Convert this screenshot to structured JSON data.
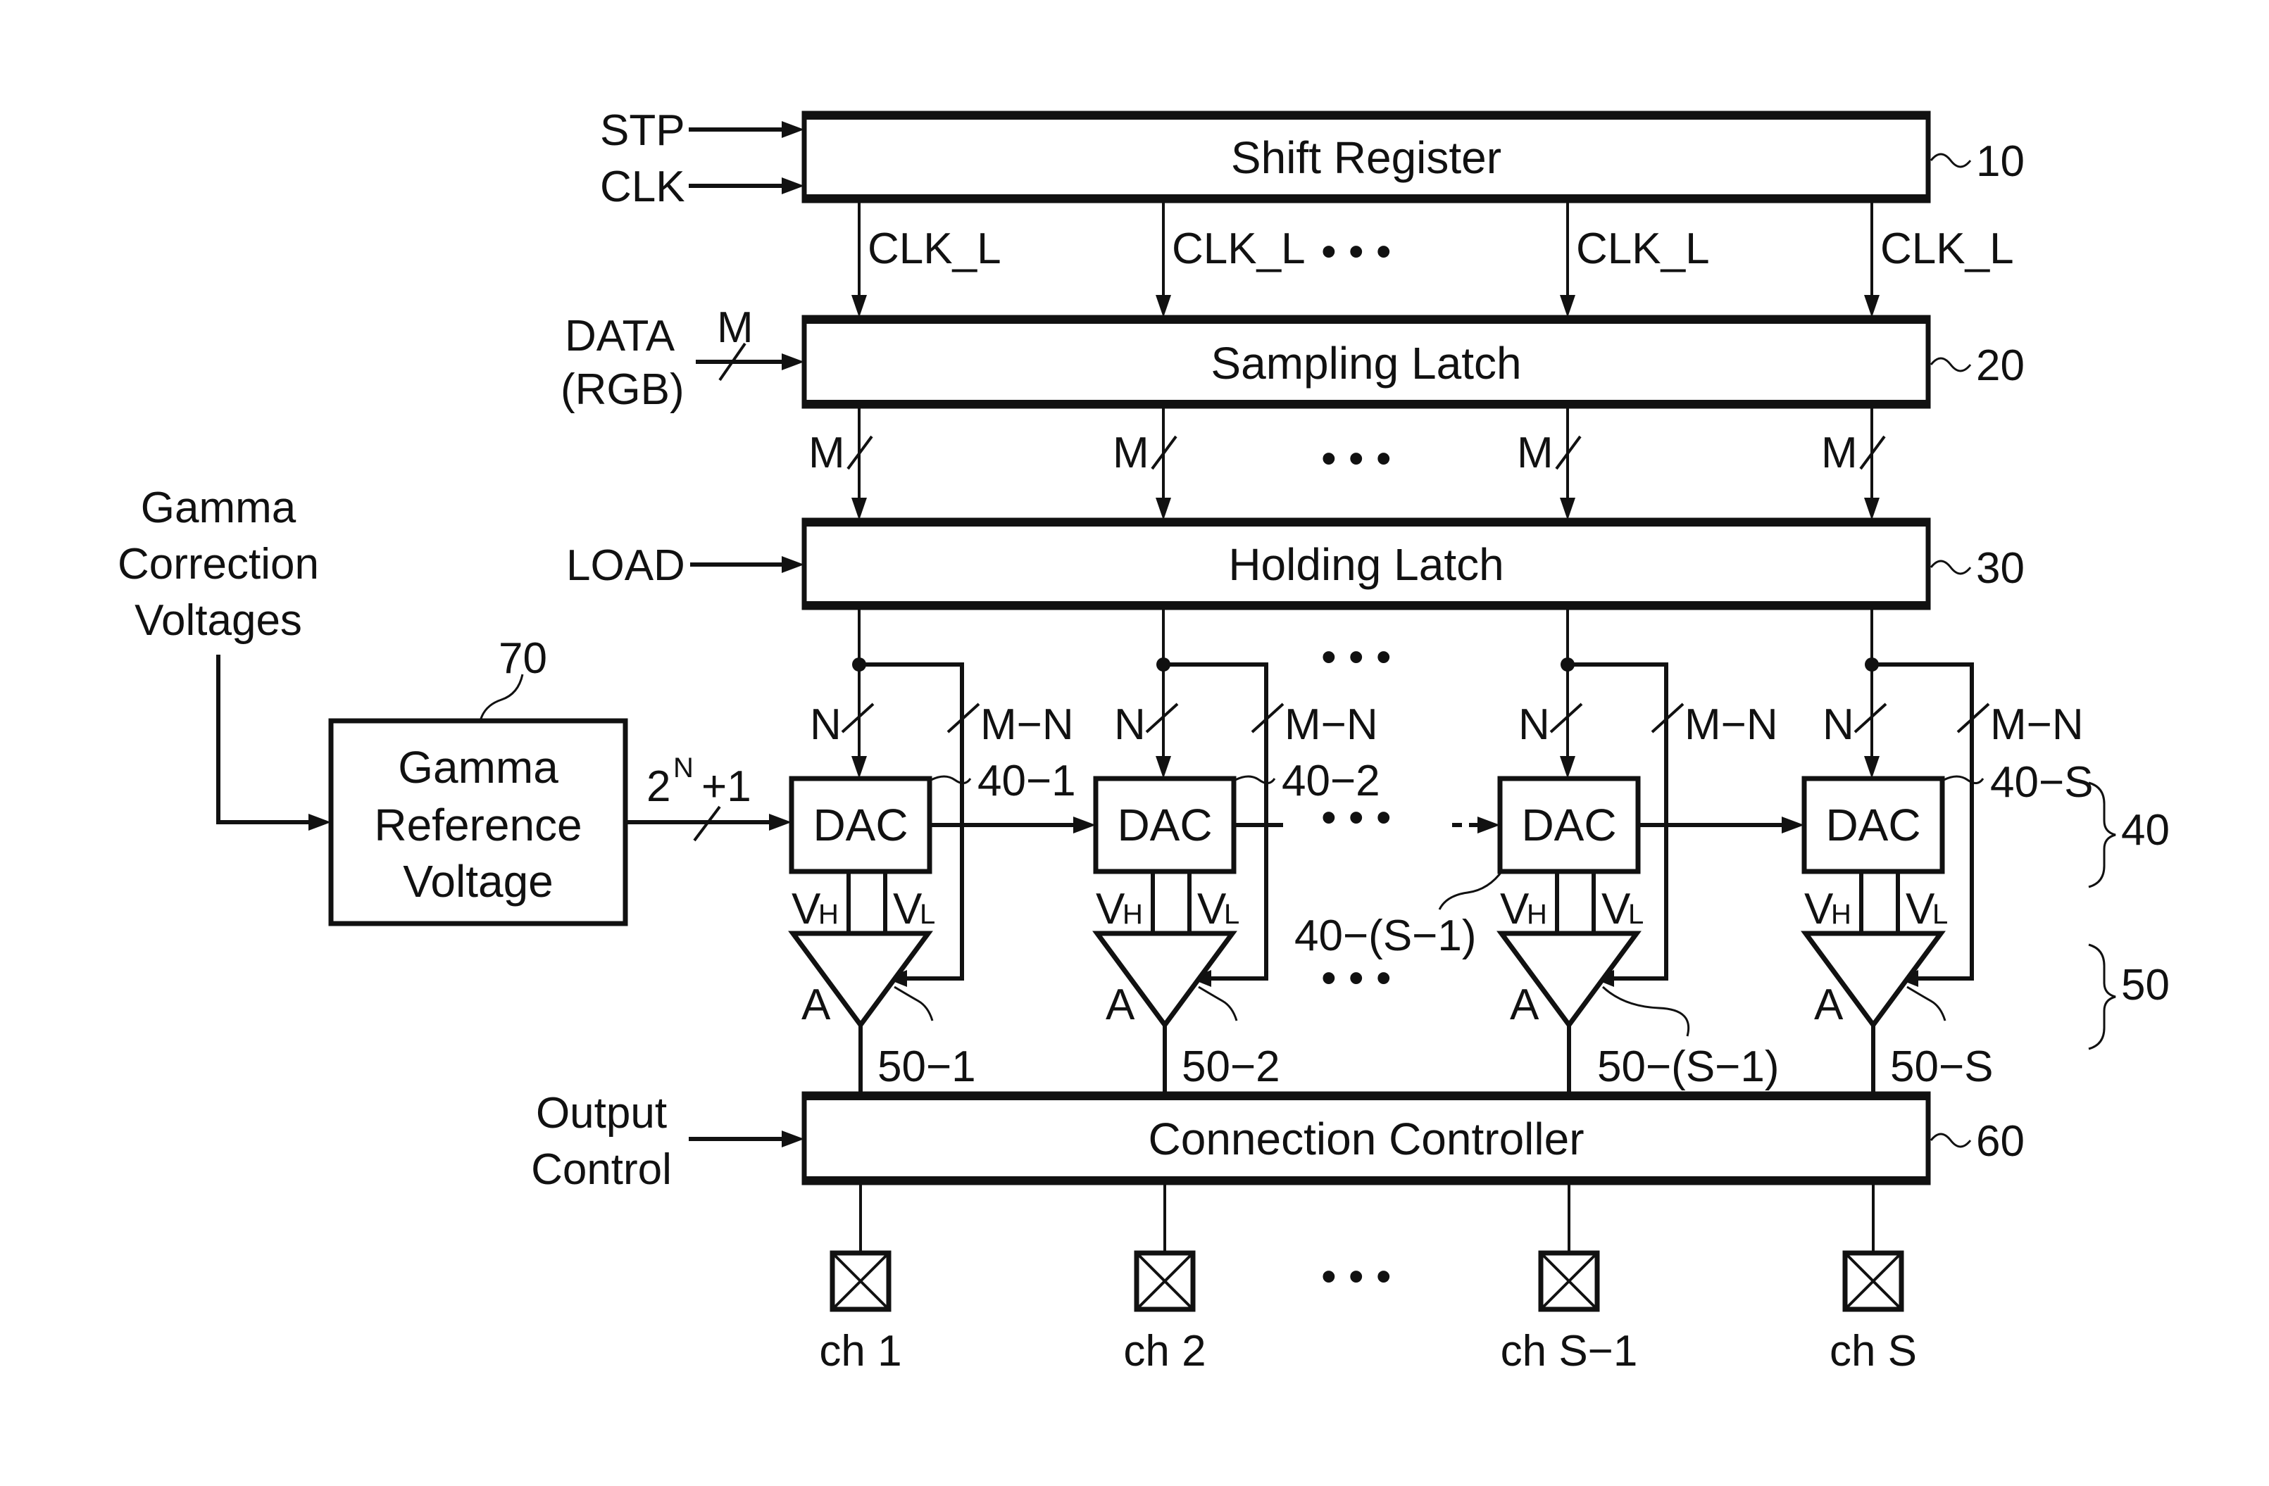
{
  "figure": {
    "colors": {
      "ink": "#111111",
      "background": "#ffffff"
    },
    "inputs": {
      "stp": "STP",
      "clk": "CLK",
      "data_line1": "DATA",
      "data_line2": "(RGB)",
      "data_bus_width": "M",
      "load": "LOAD",
      "gamma_correction": [
        "Gamma",
        "Correction",
        "Voltages"
      ],
      "output_control": [
        "Output",
        "Control"
      ]
    },
    "blocks": {
      "shift_register": {
        "title": "Shift Register",
        "ref": "10"
      },
      "sampling_latch": {
        "title": "Sampling Latch",
        "ref": "20"
      },
      "holding_latch": {
        "title": "Holding Latch",
        "ref": "30"
      },
      "connection_controller": {
        "title": "Connection Controller",
        "ref": "60"
      },
      "gamma_reference": {
        "title": [
          "Gamma",
          "Reference",
          "Voltage"
        ],
        "ref": "70"
      }
    },
    "gamma_bus": {
      "base": "2",
      "exponent": "N",
      "suffix": "+1"
    },
    "clk_label": "CLK_L",
    "latch_bus_label": "M",
    "dac_bus_label": "N",
    "bypass_bus_label": "M−N",
    "ellipsis": "• • •",
    "dac_label": "DAC",
    "amp_label": "A",
    "vh": {
      "main": "V",
      "sub": "H"
    },
    "vl": {
      "main": "V",
      "sub": "L"
    },
    "group_refs": {
      "dac_group": "40",
      "amp_group": "50"
    },
    "columns": [
      {
        "dac_ref": "40−1",
        "amp_ref": "50−1",
        "channel": "ch 1"
      },
      {
        "dac_ref": "40−2",
        "amp_ref": "50−2",
        "channel": "ch 2"
      },
      {
        "dac_ref": "40−(S−1)",
        "amp_ref": "50−(S−1)",
        "channel": "ch S−1"
      },
      {
        "dac_ref": "40−S",
        "amp_ref": "50−S",
        "channel": "ch S"
      }
    ]
  }
}
